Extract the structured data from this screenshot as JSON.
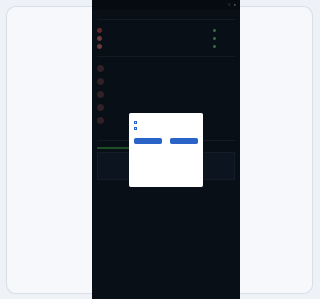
{
  "topbar": {
    "brand": "",
    "icons": [
      "menu-icon",
      "profile-icon"
    ]
  },
  "page": {
    "subtitle": "",
    "title": ""
  },
  "section_a": {
    "title": "",
    "col_left": "",
    "col_right": ""
  },
  "rows": [
    {
      "name": "",
      "date": "",
      "status": "",
      "icon_color": "#b24a4a"
    },
    {
      "name": "",
      "date": "",
      "status": "",
      "icon_color": "#c96b6b"
    },
    {
      "name": "",
      "date": "",
      "status": "",
      "icon_color": "#c96b6b"
    }
  ],
  "section_b": {
    "title": ""
  },
  "activity": [
    {
      "name": "",
      "text": ""
    },
    {
      "name": "",
      "text": ""
    },
    {
      "name": "",
      "text": ""
    },
    {
      "name": "",
      "text": ""
    },
    {
      "name": "",
      "text": ""
    }
  ],
  "section_c": {
    "title": "",
    "notice_title": "",
    "button": ""
  },
  "footer": {
    "text": ""
  },
  "modal": {
    "title": "",
    "body": "",
    "options": [
      {
        "text": ""
      },
      {
        "text": ""
      }
    ],
    "link": "",
    "buttons": [
      {
        "label": ""
      },
      {
        "label": ""
      }
    ]
  }
}
